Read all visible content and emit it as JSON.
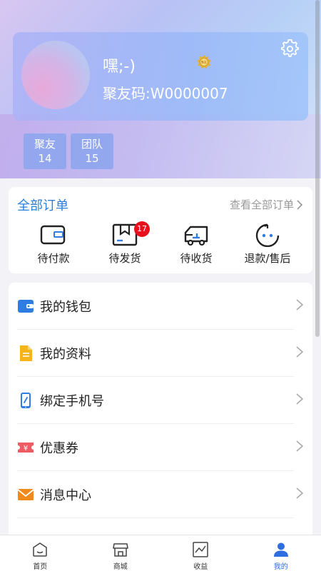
{
  "profile": {
    "nickname": "嘿;-)",
    "member_code": "聚友码:W0000007",
    "badge_text": "聚友"
  },
  "stats": [
    {
      "label": "聚友",
      "value": "14"
    },
    {
      "label": "团队",
      "value": "15"
    }
  ],
  "orders": {
    "title": "全部订单",
    "view_all": "查看全部订单",
    "items": [
      {
        "label": "待付款"
      },
      {
        "label": "待发货",
        "badge": "17"
      },
      {
        "label": "待收货"
      },
      {
        "label": "退款/售后"
      }
    ]
  },
  "menu": [
    {
      "label": "我的钱包",
      "icon": "wallet-icon",
      "color": "#2f7de1"
    },
    {
      "label": "我的资料",
      "icon": "document-icon",
      "color": "#f5b41c"
    },
    {
      "label": "绑定手机号",
      "icon": "phone-link-icon",
      "color": "#2f7de1"
    },
    {
      "label": "优惠券",
      "icon": "coupon-icon",
      "color": "#ee5b63"
    },
    {
      "label": "消息中心",
      "icon": "envelope-icon",
      "color": "#f08a1c"
    }
  ],
  "tabs": [
    {
      "label": "首页"
    },
    {
      "label": "商城"
    },
    {
      "label": "收益"
    },
    {
      "label": "我的",
      "active": true
    }
  ],
  "colors": {
    "accent": "#2b7fd9",
    "tab_active": "#2f6ee0",
    "badge_red": "#e8101c"
  }
}
